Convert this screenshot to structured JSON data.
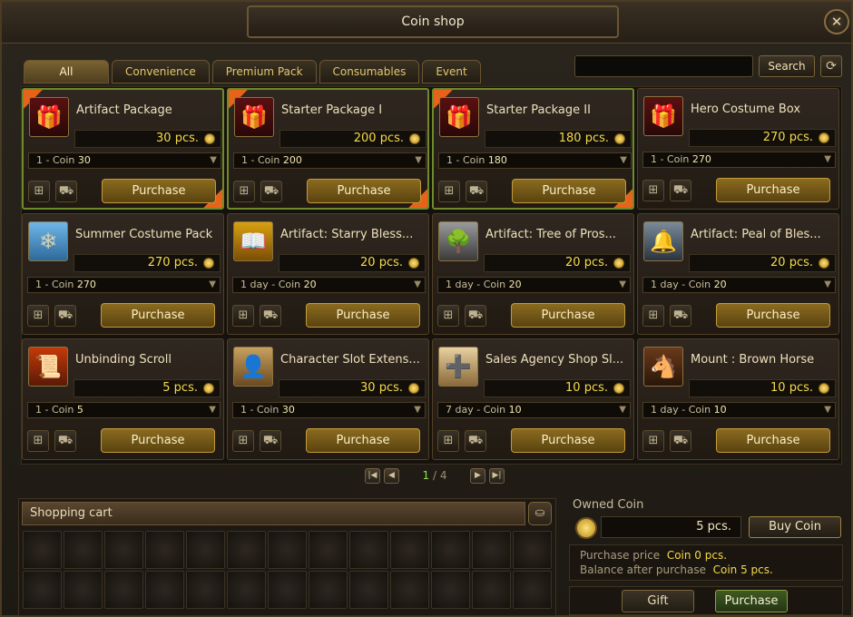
{
  "window": {
    "title": "Coin shop"
  },
  "tabs": [
    {
      "label": "All"
    },
    {
      "label": "Convenience"
    },
    {
      "label": "Premium Pack"
    },
    {
      "label": "Consumables"
    },
    {
      "label": "Event"
    }
  ],
  "search": {
    "button_label": "Search"
  },
  "items": [
    {
      "name": "Artifact Package",
      "qty": "30 pcs.",
      "price_prefix": "1 - Coin",
      "price": "30",
      "purchase_label": "Purchase",
      "icon": "gift-chest-icon"
    },
    {
      "name": "Starter Package I",
      "qty": "200 pcs.",
      "price_prefix": "1 - Coin",
      "price": "200",
      "purchase_label": "Purchase",
      "icon": "gift-chest-icon"
    },
    {
      "name": "Starter Package II",
      "qty": "180 pcs.",
      "price_prefix": "1 - Coin",
      "price": "180",
      "purchase_label": "Purchase",
      "icon": "gift-chest-icon"
    },
    {
      "name": "Hero Costume Box",
      "qty": "270 pcs.",
      "price_prefix": "1 - Coin",
      "price": "270",
      "purchase_label": "Purchase",
      "icon": "gift-chest-icon"
    },
    {
      "name": "Summer Costume Pack",
      "qty": "270 pcs.",
      "price_prefix": "1 - Coin",
      "price": "270",
      "purchase_label": "Purchase",
      "icon": "ice-cube-icon"
    },
    {
      "name": "Artifact: Starry Bless...",
      "qty": "20 pcs.",
      "price_prefix": "1 day - Coin",
      "price": "20",
      "purchase_label": "Purchase",
      "icon": "glowing-book-icon"
    },
    {
      "name": "Artifact: Tree of Pros...",
      "qty": "20 pcs.",
      "price_prefix": "1 day - Coin",
      "price": "20",
      "purchase_label": "Purchase",
      "icon": "tree-medallion-icon"
    },
    {
      "name": "Artifact: Peal of Bles...",
      "qty": "20 pcs.",
      "price_prefix": "1 day - Coin",
      "price": "20",
      "purchase_label": "Purchase",
      "icon": "bell-icon"
    },
    {
      "name": "Unbinding Scroll",
      "qty": "5 pcs.",
      "price_prefix": "1 - Coin",
      "price": "5",
      "purchase_label": "Purchase",
      "icon": "scroll-icon"
    },
    {
      "name": "Character Slot Extens...",
      "qty": "30 pcs.",
      "price_prefix": "1 - Coin",
      "price": "30",
      "purchase_label": "Purchase",
      "icon": "character-card-icon"
    },
    {
      "name": "Sales Agency Shop Sl...",
      "qty": "10 pcs.",
      "price_prefix": "7 day - Coin",
      "price": "10",
      "purchase_label": "Purchase",
      "icon": "parchment-plus-icon"
    },
    {
      "name": "Mount : Brown Horse",
      "qty": "10 pcs.",
      "price_prefix": "1 day - Coin",
      "price": "10",
      "purchase_label": "Purchase",
      "icon": "horse-icon"
    }
  ],
  "pagination": {
    "current": "1",
    "separator": " / ",
    "total": "4"
  },
  "cart": {
    "title": "Shopping cart",
    "slot_count": 26
  },
  "wallet": {
    "owned_label": "Owned Coin",
    "owned_value": "5 pcs.",
    "buy_coin_label": "Buy Coin",
    "purchase_price_label": "Purchase price",
    "purchase_price_value": "Coin 0 pcs.",
    "balance_label": "Balance after purchase",
    "balance_value": "Coin 5 pcs."
  },
  "actions": {
    "gift_label": "Gift",
    "purchase_label": "Purchase"
  },
  "colors": {
    "accent_gold": "#f4d94a",
    "featured_border": "#6e8a2a",
    "ribbon": "#e8631a"
  }
}
